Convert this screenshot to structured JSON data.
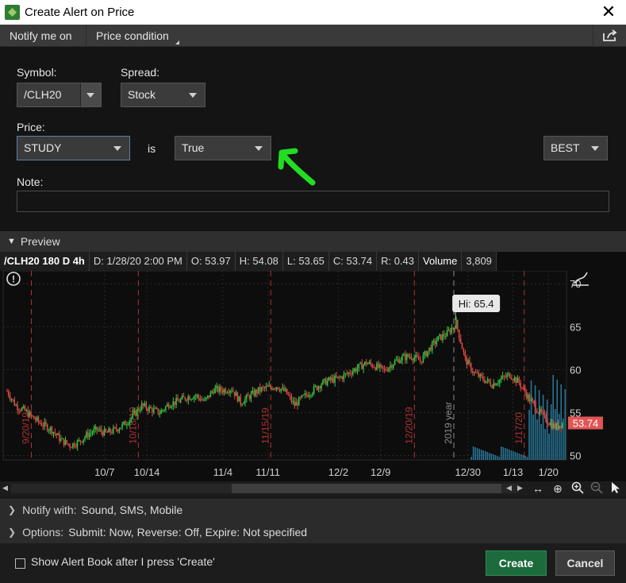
{
  "window": {
    "title": "Create Alert on Price",
    "close_label": "✕"
  },
  "tabs": [
    {
      "label": "Notify me on"
    },
    {
      "label": "Price condition"
    }
  ],
  "form": {
    "symbol_label": "Symbol:",
    "symbol_value": "/CLH20",
    "spread_label": "Spread:",
    "spread_value": "Stock",
    "price_label": "Price:",
    "price_value": "STUDY",
    "is_label": "is",
    "condition_value": "True",
    "best_value": "BEST",
    "note_label": "Note:",
    "note_value": ""
  },
  "preview": {
    "header_label": "Preview",
    "quote": {
      "symbol": "/CLH20 180 D 4h",
      "date": "D: 1/28/20 2:00 PM",
      "open": "O: 53.97",
      "high": "H: 54.08",
      "low": "L: 53.65",
      "close": "C: 53.74",
      "range": "R: 0.43",
      "volume_label": "Volume",
      "volume_value": "3,809"
    }
  },
  "chart_data": {
    "type": "candlestick",
    "hi_label": "Hi: 65.4",
    "last_price_label": "53.74",
    "y_ticks": [
      "70",
      "65",
      "60",
      "55",
      "50"
    ],
    "ylim": [
      49.5,
      71.5
    ],
    "x_ticks": [
      "10/7",
      "10/14",
      "11/4",
      "11/11",
      "12/2",
      "12/9",
      "12/30",
      "1/13",
      "1/20"
    ],
    "vertical_labels": [
      "9/20/19",
      "10/18/19",
      "11/15/19",
      "12/20/19",
      "2019 year",
      "1/17/20"
    ],
    "price_path": [
      57.5,
      55.8,
      55.2,
      54.3,
      53.6,
      53.0,
      51.8,
      51.2,
      51.6,
      52.5,
      53.0,
      52.6,
      53.0,
      53.6,
      54.6,
      55.8,
      55.4,
      55.0,
      56.0,
      56.3,
      56.8,
      57.0,
      56.3,
      57.7,
      57.6,
      57.8,
      56.2,
      56.9,
      57.6,
      57.9,
      58.1,
      57.4,
      55.9,
      56.8,
      57.6,
      58.4,
      58.8,
      59.0,
      59.6,
      60.2,
      60.8,
      60.4,
      59.9,
      60.8,
      61.4,
      61.6,
      61.0,
      62.4,
      63.6,
      64.2,
      65.4,
      61.2,
      59.6,
      58.9,
      58.3,
      58.9,
      59.4,
      58.5,
      56.8,
      55.4,
      54.2,
      53.3,
      53.8
    ],
    "colors": {
      "up": "#2ecc40",
      "down": "#e84848",
      "volume": "#2f8fb8",
      "last_price_bg": "#e05555"
    }
  },
  "toolbar": {
    "pan_icon": "arrows-horizontal-icon",
    "crosshair_icon": "crosshair-icon",
    "zoom_in_icon": "zoom-in-icon",
    "zoom_out_icon": "zoom-out-icon",
    "pointer_icon": "pointer-icon"
  },
  "notify": {
    "with_label": "Notify with:",
    "with_value": "Sound, SMS, Mobile",
    "options_label": "Options:",
    "options_value": "Submit: Now, Reverse: Off, Expire: Not specified"
  },
  "footer": {
    "checkbox_label": "Show Alert Book after I press 'Create'",
    "create_label": "Create",
    "cancel_label": "Cancel"
  }
}
